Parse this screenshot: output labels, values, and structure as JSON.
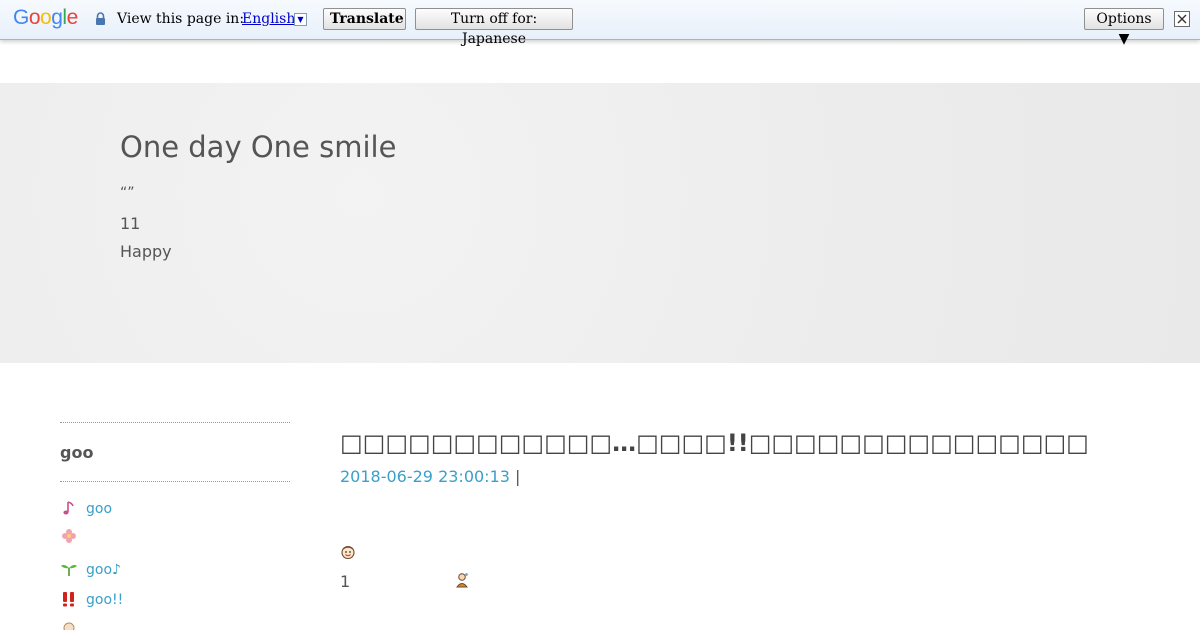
{
  "translate_bar": {
    "logo_letters": [
      "G",
      "o",
      "o",
      "g",
      "l",
      "e"
    ],
    "logo_colors": [
      "#4285f4",
      "#ea4335",
      "#fbbc05",
      "#4285f4",
      "#34a853",
      "#ea4335"
    ],
    "view_label": "View this page in:",
    "language": "English",
    "dropdown_glyph": "▼",
    "translate_label": "Translate",
    "turn_off_label": "Turn off for: Japanese",
    "options_label": "Options ▼",
    "close_glyph": "✕"
  },
  "header": {
    "title": "One day One smile",
    "quote": "“”",
    "number": "11",
    "tagline": "Happy"
  },
  "sidebar": {
    "heading": "goo",
    "items": [
      {
        "icon": "music-note-icon",
        "label": "goo"
      },
      {
        "icon": "flower-icon",
        "label": ""
      },
      {
        "icon": "sprout-icon",
        "label": "goo♪"
      },
      {
        "icon": "double-exclamation-icon",
        "label": "goo!!"
      }
    ]
  },
  "post": {
    "title": "□□□□□□□□□□□□…□□□□!!□□□□□□□□□□□□□□□",
    "date": "2018-06-29 23:00:13",
    "separator": "|",
    "first_line_number": "1"
  },
  "colors": {
    "link": "#3a9fc9",
    "text": "#555555",
    "header_bg": "#ececec"
  }
}
